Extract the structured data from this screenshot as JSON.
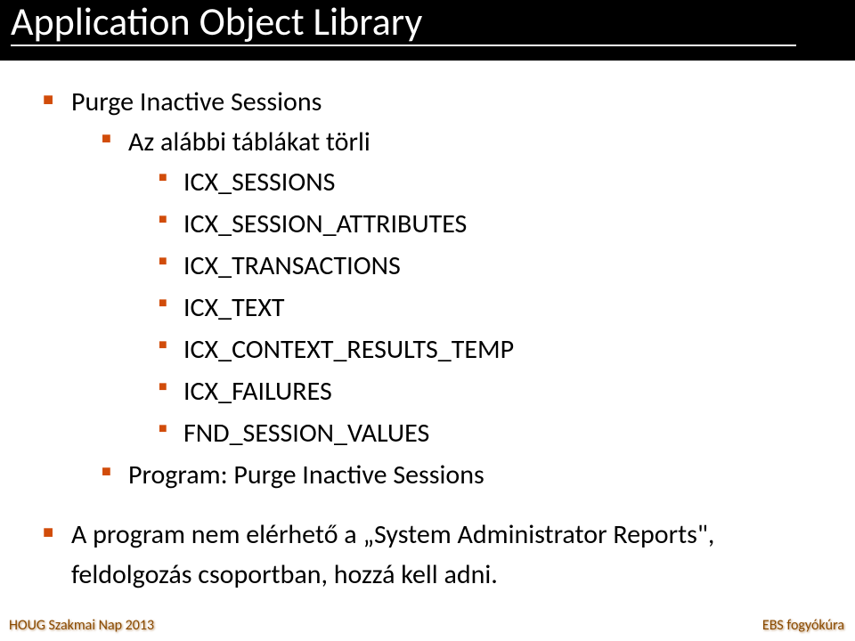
{
  "title": "Application Object Library",
  "bullets": {
    "b1": "Purge Inactive Sessions",
    "b1_1": "Az alábbi táblákat törli",
    "b1_1_1": "ICX_SESSIONS",
    "b1_1_2": "ICX_SESSION_ATTRIBUTES",
    "b1_1_3": "ICX_TRANSACTIONS",
    "b1_1_4": "ICX_TEXT",
    "b1_1_5": "ICX_CONTEXT_RESULTS_TEMP",
    "b1_1_6": "ICX_FAILURES",
    "b1_1_7": "FND_SESSION_VALUES",
    "b1_2": "Program: Purge Inactive Sessions",
    "b2": "A program nem elérhető a „System Administrator Reports\", feldolgozás csoportban, hozzá kell adni."
  },
  "footer": {
    "left": "HOUG Szakmai Nap 2013",
    "right": "EBS fogyókúra"
  }
}
